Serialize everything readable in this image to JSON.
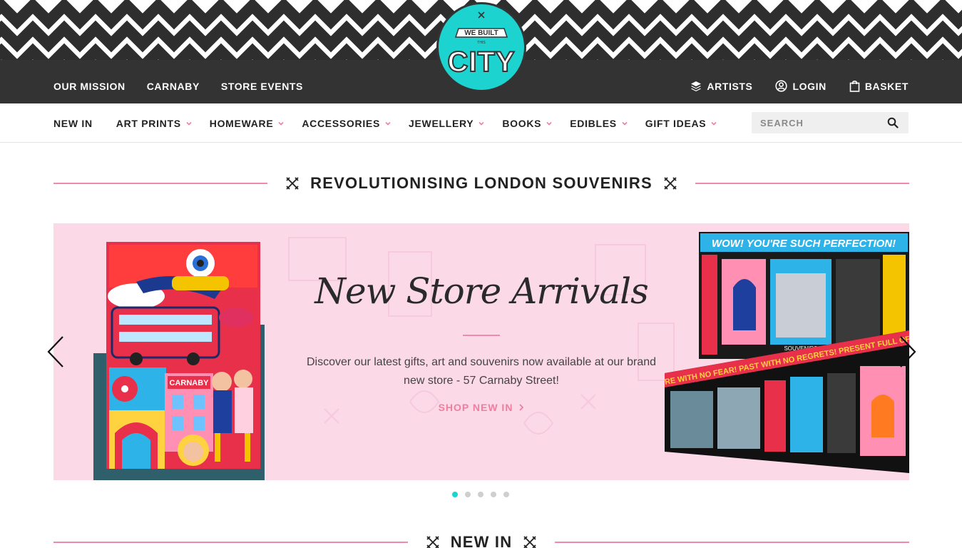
{
  "brand": {
    "logo_top": "WE BUILT",
    "logo_small": "THIS",
    "logo_main": "CITY",
    "accent": "#1dd3d0",
    "pink": "#f08aa8",
    "dark": "#333333"
  },
  "topnav": {
    "left": [
      {
        "label": "OUR MISSION"
      },
      {
        "label": "CARNABY"
      },
      {
        "label": "STORE EVENTS"
      }
    ],
    "right": [
      {
        "label": "ARTISTS",
        "icon": "layers-icon"
      },
      {
        "label": "LOGIN",
        "icon": "user-circle-icon"
      },
      {
        "label": "BASKET",
        "icon": "shopping-bag-icon"
      }
    ]
  },
  "categories": [
    {
      "label": "NEW IN",
      "dropdown": false
    },
    {
      "label": "ART PRINTS",
      "dropdown": true
    },
    {
      "label": "HOMEWARE",
      "dropdown": true
    },
    {
      "label": "ACCESSORIES",
      "dropdown": true
    },
    {
      "label": "JEWELLERY",
      "dropdown": true
    },
    {
      "label": "BOOKS",
      "dropdown": true
    },
    {
      "label": "EDIBLES",
      "dropdown": true
    },
    {
      "label": "GIFT IDEAS",
      "dropdown": true
    }
  ],
  "search": {
    "placeholder": "SEARCH",
    "value": ""
  },
  "headline": {
    "title": "REVOLUTIONISING LONDON SOUVENIRS"
  },
  "hero": {
    "title": "New Store Arrivals",
    "description": "Discover our latest gifts, art and souvenirs now available at our brand new store - 57 Carnaby Street!",
    "cta": "SHOP NEW IN",
    "poster_label": "CARNABY",
    "sign_top": "WOW! YOU'RE SUCH PERFECTION!",
    "sign_bottom": "FOOTURE WITH NO FEAR! PAST WITH NO REGRETS! PRESENT FULL OF LOVE",
    "store_label": "SOUVENIRS",
    "slides_total": 5,
    "active_slide": 1
  },
  "next_section": {
    "title": "NEW IN"
  }
}
